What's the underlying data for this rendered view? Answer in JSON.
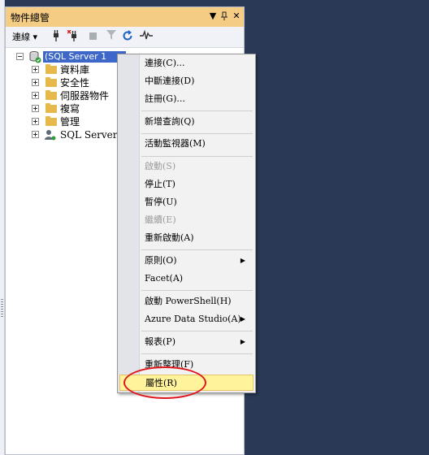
{
  "panel": {
    "title": "物件總管",
    "controls": {
      "dropdown": "▼",
      "pin": "ꟷ",
      "close": "✕"
    }
  },
  "toolbar": {
    "connect_label": "連線",
    "connect_arrow": "▾",
    "icons": [
      "connect-plug-icon",
      "disconnect-plug-icon",
      "stop-icon",
      "filter-icon",
      "refresh-icon",
      "activity-monitor-icon"
    ]
  },
  "tree": {
    "server": {
      "label": "(SQL Server 1",
      "expanded": true
    },
    "items": [
      {
        "label": "資料庫",
        "icon": "folder-icon"
      },
      {
        "label": "安全性",
        "icon": "folder-icon"
      },
      {
        "label": "伺服器物件",
        "icon": "folder-icon"
      },
      {
        "label": "複寫",
        "icon": "folder-icon"
      },
      {
        "label": "管理",
        "icon": "folder-icon"
      },
      {
        "label": "SQL Server Ag",
        "icon": "agent-icon"
      }
    ]
  },
  "context_menu": {
    "items": [
      {
        "label": "連接(C)...",
        "enabled": true
      },
      {
        "label": "中斷連接(D)",
        "enabled": true
      },
      {
        "label": "註冊(G)...",
        "enabled": true
      },
      {
        "label": "新增查詢(Q)",
        "enabled": true
      },
      {
        "label": "活動監視器(M)",
        "enabled": true
      },
      {
        "label": "啟動(S)",
        "enabled": false
      },
      {
        "label": "停止(T)",
        "enabled": true
      },
      {
        "label": "暫停(U)",
        "enabled": true
      },
      {
        "label": "繼續(E)",
        "enabled": false
      },
      {
        "label": "重新啟動(A)",
        "enabled": true
      },
      {
        "label": "原則(O)",
        "enabled": true,
        "submenu": true
      },
      {
        "label": "Facet(A)",
        "enabled": true
      },
      {
        "label": "啟動 PowerShell(H)",
        "enabled": true
      },
      {
        "label": "Azure Data Studio(A)",
        "enabled": true,
        "submenu": true
      },
      {
        "label": "報表(P)",
        "enabled": true,
        "submenu": true
      },
      {
        "label": "重新整理(F)",
        "enabled": true
      },
      {
        "label": "屬性(R)",
        "enabled": true,
        "highlighted": true
      }
    ],
    "submenu_arrow": "▶"
  },
  "colors": {
    "background": "#293956",
    "title_bar": "#f5cc84",
    "selection": "#3d68c9",
    "menu_highlight": "#fff39c",
    "annotation": "#e0141b"
  }
}
